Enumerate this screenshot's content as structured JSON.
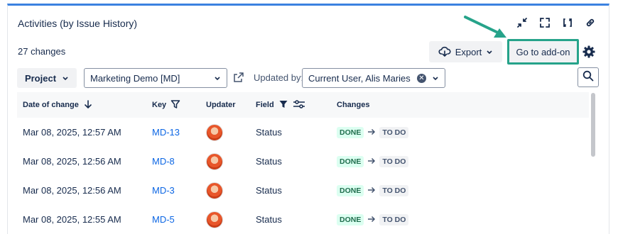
{
  "header": {
    "title": "Activities (by Issue History)"
  },
  "summary": {
    "count": "27 changes"
  },
  "toolbar": {
    "export_label": "Export",
    "addon_label": "Go to add-on"
  },
  "filters": {
    "project_label": "Project",
    "project_value": "Marketing Demo [MD]",
    "updated_by_label": "Updated by:",
    "updated_by_value": "Current User, Alis Maries"
  },
  "columns": {
    "date": "Date of change",
    "key": "Key",
    "updater": "Updater",
    "field": "Field",
    "changes": "Changes"
  },
  "rows": [
    {
      "date": "Mar 08, 2025, 12:57 AM",
      "key": "MD-13",
      "field": "Status",
      "from": "DONE",
      "to": "TO DO"
    },
    {
      "date": "Mar 08, 2025, 12:56 AM",
      "key": "MD-8",
      "field": "Status",
      "from": "DONE",
      "to": "TO DO"
    },
    {
      "date": "Mar 08, 2025, 12:56 AM",
      "key": "MD-3",
      "field": "Status",
      "from": "DONE",
      "to": "TO DO"
    },
    {
      "date": "Mar 08, 2025, 12:55 AM",
      "key": "MD-5",
      "field": "Status",
      "from": "DONE",
      "to": "TO DO"
    }
  ],
  "icons": {
    "minimize": "minimize-icon",
    "fullscreen": "fullscreen-icon",
    "refresh": "refresh-icon",
    "link": "link-icon",
    "export": "cloud-download-icon",
    "settings": "gear-icon",
    "external": "external-link-icon",
    "search": "search-icon",
    "sort": "arrow-down-icon",
    "filter": "filter-icon",
    "annotation": "arrow-annotation"
  },
  "colors": {
    "accent": "#3b82e0",
    "highlight": "#26a38a",
    "link": "#0c66e4"
  }
}
